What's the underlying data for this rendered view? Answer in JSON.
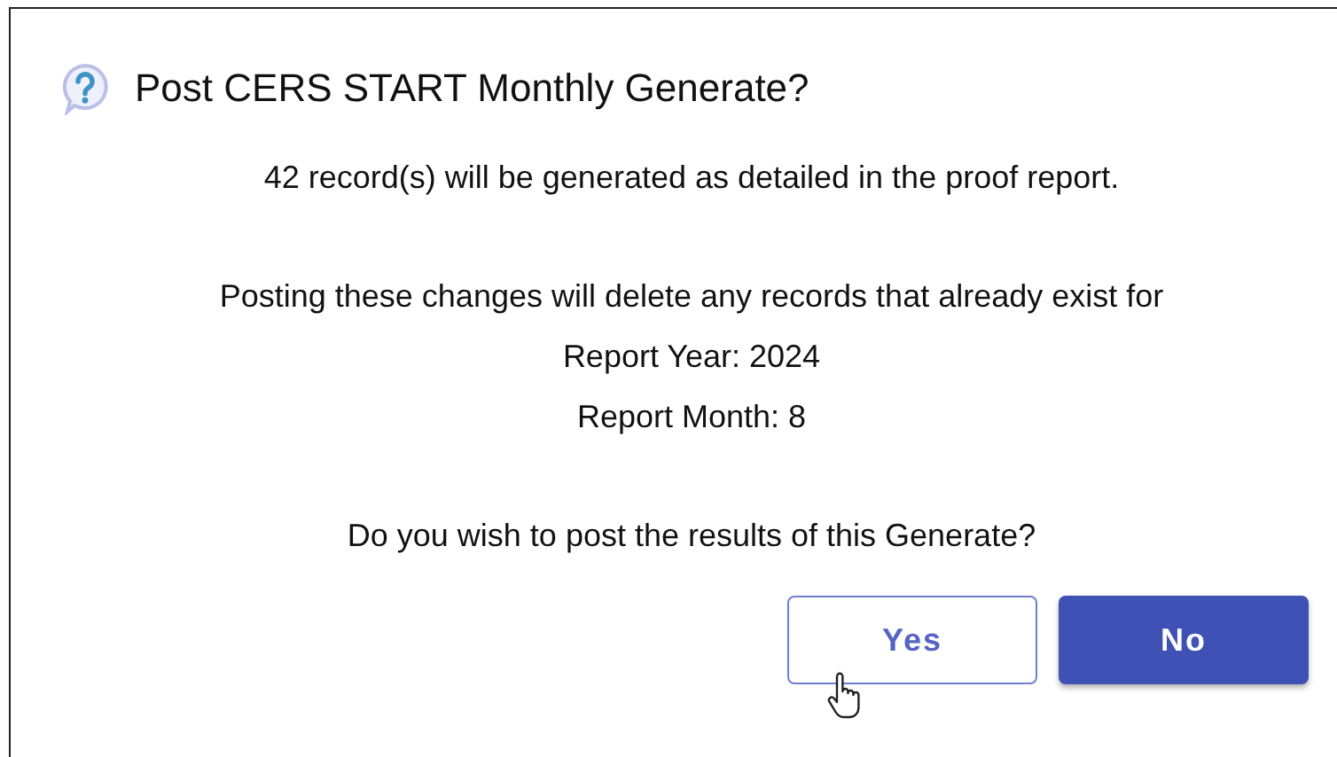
{
  "dialog": {
    "title": "Post CERS START Monthly Generate?",
    "message_lines": [
      "42 record(s) will be generated as detailed in the proof report."
    ],
    "detail_lines": [
      "Posting these changes will delete any records that already exist for",
      "Report Year: 2024",
      "Report Month: 8"
    ],
    "question": "Do you wish to post the results of this Generate?",
    "buttons": [
      {
        "label": "Yes",
        "kind": "outlined"
      },
      {
        "label": "No",
        "kind": "filled"
      }
    ]
  }
}
